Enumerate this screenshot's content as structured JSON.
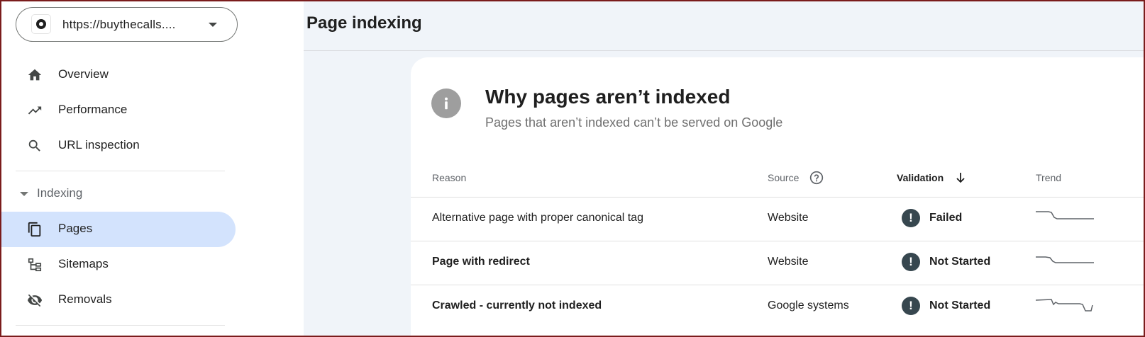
{
  "property": {
    "url": "https://buythecalls...."
  },
  "sidebar": {
    "items": [
      {
        "label": "Overview",
        "icon": "home-icon"
      },
      {
        "label": "Performance",
        "icon": "trending-up-icon"
      },
      {
        "label": "URL inspection",
        "icon": "search-icon"
      }
    ],
    "indexing_section": {
      "label": "Indexing",
      "items": [
        {
          "label": "Pages",
          "icon": "pages-icon",
          "active": true
        },
        {
          "label": "Sitemaps",
          "icon": "sitemap-icon"
        },
        {
          "label": "Removals",
          "icon": "eye-off-icon"
        }
      ]
    }
  },
  "header": {
    "title": "Page indexing"
  },
  "card": {
    "title": "Why pages aren’t indexed",
    "subtitle": "Pages that aren’t indexed can’t be served on Google",
    "columns": {
      "reason": "Reason",
      "source": "Source",
      "validation": "Validation",
      "trend": "Trend"
    },
    "rows": [
      {
        "reason": "Alternative page with proper canonical tag",
        "source": "Website",
        "validation": "Failed"
      },
      {
        "reason": "Page with redirect",
        "source": "Website",
        "validation": "Not Started"
      },
      {
        "reason": "Crawled - currently not indexed",
        "source": "Google systems",
        "validation": "Not Started"
      }
    ]
  },
  "colors": {
    "active_nav_bg": "#d3e3fd",
    "page_bg": "#f0f4f9",
    "status_icon": "#37474f"
  }
}
